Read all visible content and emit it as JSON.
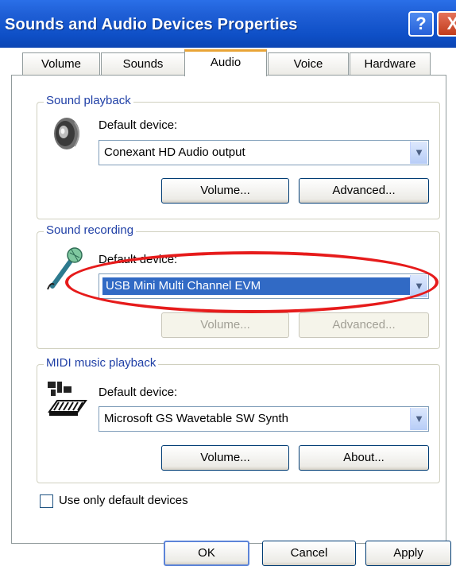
{
  "window": {
    "title": "Sounds and Audio Devices Properties",
    "help_glyph": "?",
    "close_glyph": "X"
  },
  "tabs": [
    {
      "label": "Volume",
      "active": false
    },
    {
      "label": "Sounds",
      "active": false
    },
    {
      "label": "Audio",
      "active": true
    },
    {
      "label": "Voice",
      "active": false
    },
    {
      "label": "Hardware",
      "active": false
    }
  ],
  "playback": {
    "group_label": "Sound playback",
    "icon": "speaker-icon",
    "device_label": "Default device:",
    "device_value": "Conexant HD Audio output",
    "volume_button": "Volume...",
    "advanced_button": "Advanced..."
  },
  "recording": {
    "group_label": "Sound recording",
    "icon": "microphone-icon",
    "device_label": "Default device:",
    "device_value": "USB Mini Multi Channel EVM",
    "volume_button": "Volume...",
    "advanced_button": "Advanced...",
    "buttons_disabled": true,
    "highlight_color": "#e61b1b"
  },
  "midi": {
    "group_label": "MIDI music playback",
    "icon": "midi-keyboard-icon",
    "device_label": "Default device:",
    "device_value": "Microsoft GS Wavetable SW Synth",
    "volume_button": "Volume...",
    "about_button": "About..."
  },
  "options": {
    "use_default_only_label": "Use only default devices",
    "use_default_only_checked": false
  },
  "footer": {
    "ok": "OK",
    "cancel": "Cancel",
    "apply": "Apply"
  },
  "colors": {
    "titlebar": "#0e4fc6",
    "selection": "#316ac5",
    "group_label": "#1f3fa6"
  }
}
